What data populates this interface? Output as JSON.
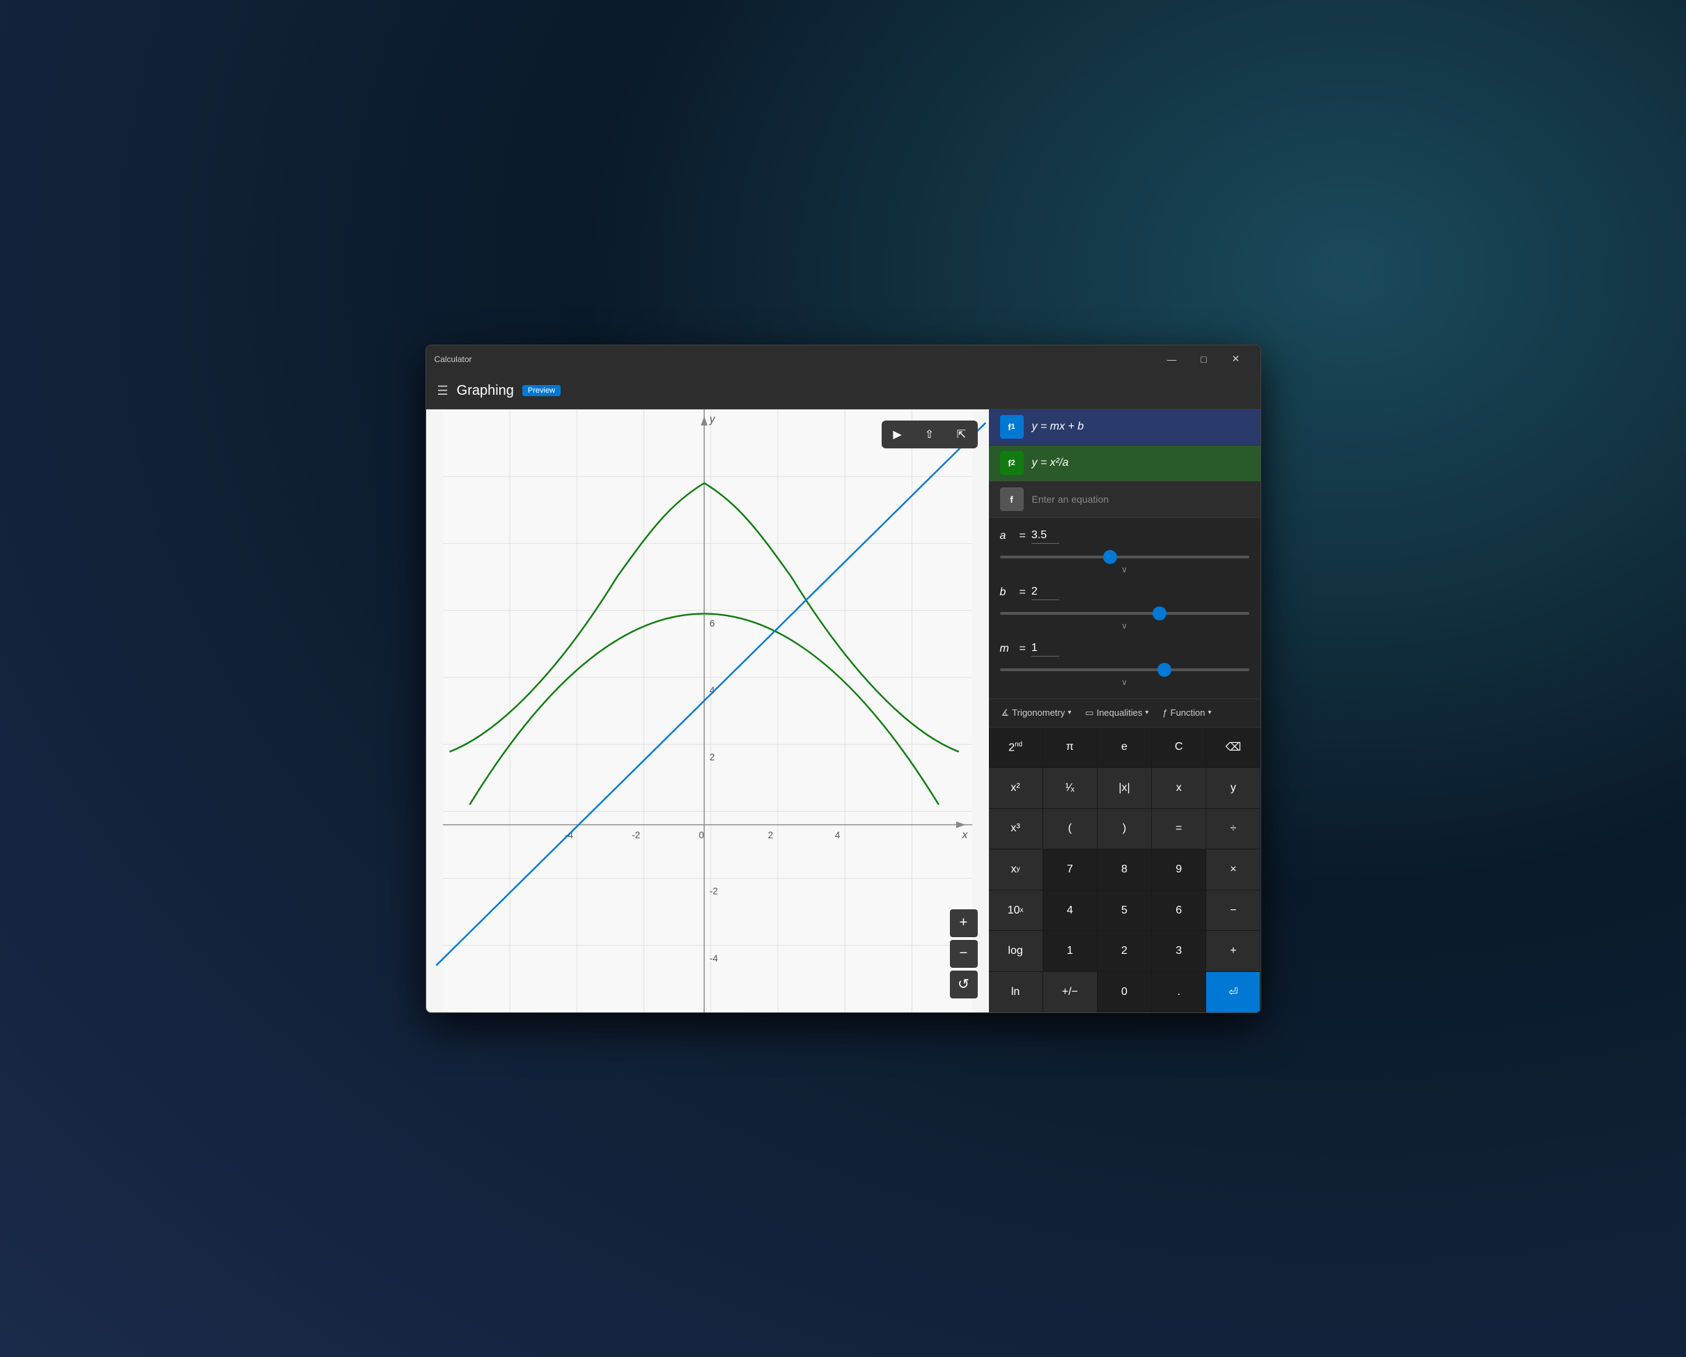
{
  "titlebar": {
    "title": "Calculator",
    "minimize": "—",
    "maximize": "□",
    "close": "✕"
  },
  "header": {
    "title": "Graphing",
    "badge": "Preview"
  },
  "functions": [
    {
      "id": "f1",
      "badge": "f₁",
      "equation": "y = mx + b",
      "color": "blue"
    },
    {
      "id": "f2",
      "badge": "f₂",
      "equation": "y = x²/a",
      "color": "green"
    },
    {
      "id": "f3",
      "badge": "f",
      "placeholder": "Enter an equation",
      "color": "grey"
    }
  ],
  "variables": [
    {
      "name": "a",
      "value": "3.5",
      "sliderPct": 44
    },
    {
      "name": "b",
      "value": "2",
      "sliderPct": 65
    },
    {
      "name": "m",
      "value": "1",
      "sliderPct": 67
    }
  ],
  "toolbar_buttons": [
    {
      "id": "trig",
      "label": "Trigonometry",
      "icon": "∡"
    },
    {
      "id": "ineq",
      "label": "Inequalities",
      "icon": "▭"
    },
    {
      "id": "func",
      "label": "Function",
      "icon": "ƒ"
    }
  ],
  "keypad": [
    [
      "2ⁿᵈ",
      "π",
      "e",
      "C",
      "⌫"
    ],
    [
      "x²",
      "¹/x",
      "|x|",
      "x",
      "y"
    ],
    [
      "x³",
      "(",
      ")",
      "=",
      "÷"
    ],
    [
      "xʸ",
      "7",
      "8",
      "9",
      "×"
    ],
    [
      "10ˣ",
      "4",
      "5",
      "6",
      "−"
    ],
    [
      "log",
      "1",
      "2",
      "3",
      "+"
    ],
    [
      "ln",
      "+/−",
      "0",
      ".",
      "⏎"
    ]
  ],
  "graph": {
    "xMin": -5,
    "xMax": 5,
    "yMin": -5,
    "yMax": 8,
    "xLabel": "x",
    "yLabel": "y",
    "gridStep": 2
  },
  "zoom": {
    "plus": "+",
    "minus": "−",
    "reset": "↺"
  }
}
